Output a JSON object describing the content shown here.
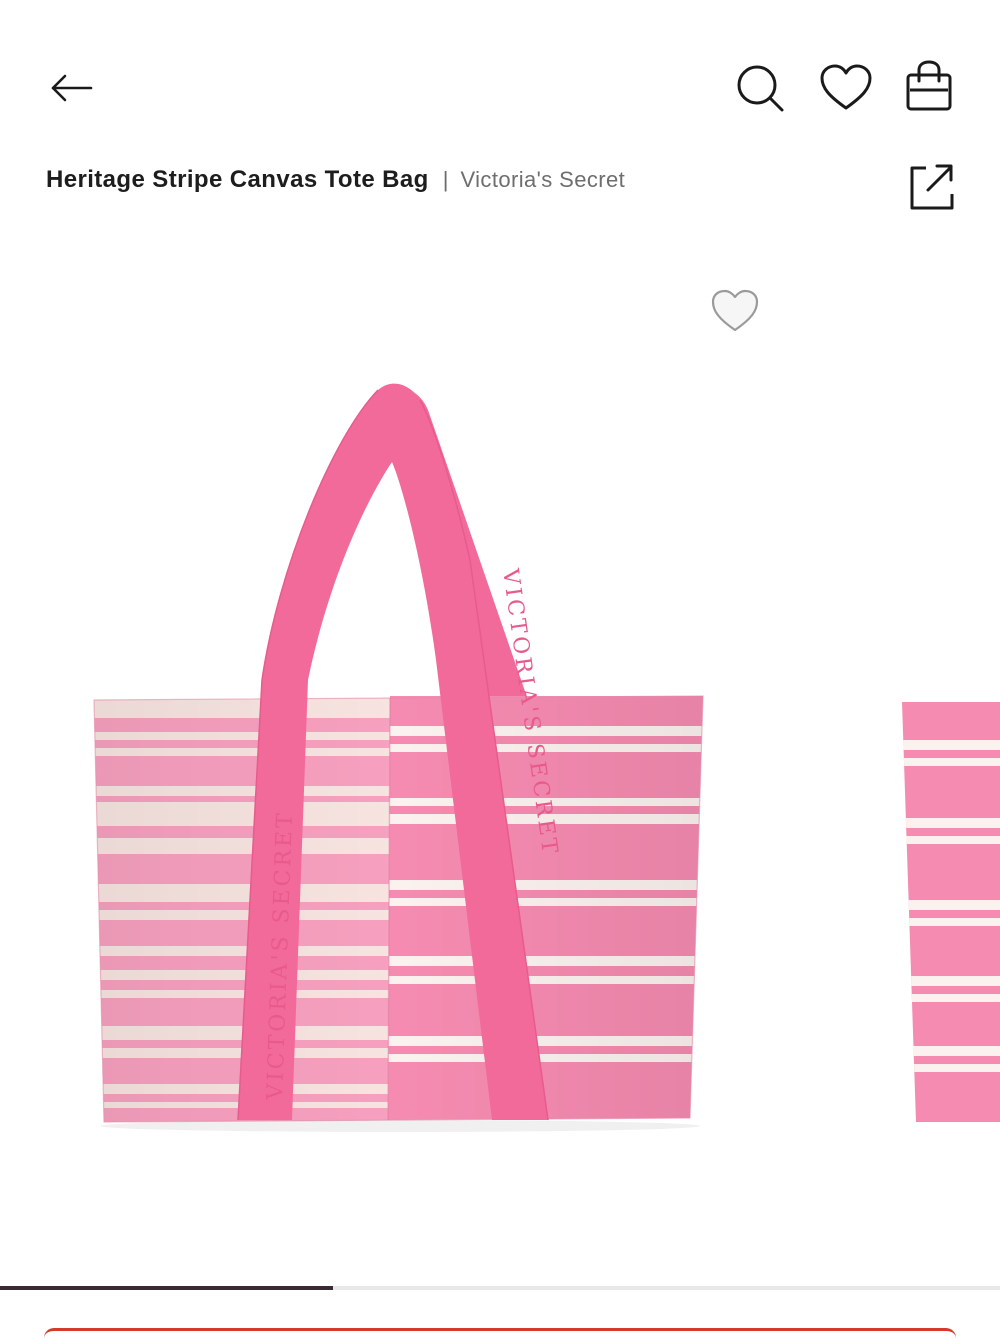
{
  "header": {
    "back_icon": "arrow-left-icon",
    "search_icon": "search-icon",
    "wishlist_icon": "heart-icon",
    "bag_icon": "shopping-bag-icon"
  },
  "product": {
    "title": "Heritage Stripe Canvas Tote Bag",
    "separator": "|",
    "brand": "Victoria's Secret",
    "share_icon": "share-icon"
  },
  "gallery": {
    "favorite_icon": "heart-outline-icon",
    "strap_text": "VICTORIA'S SECRET",
    "colors": {
      "pink": "#f58bb0",
      "pink_light": "#f9a9c5",
      "cream": "#f7e4e0",
      "strap": "#f26a9a",
      "stripe_white": "#fbf2ef"
    },
    "progress_fraction": 0.333
  },
  "colors": {
    "progress": "#3a2b33",
    "cta_border": "#d63a2f"
  }
}
